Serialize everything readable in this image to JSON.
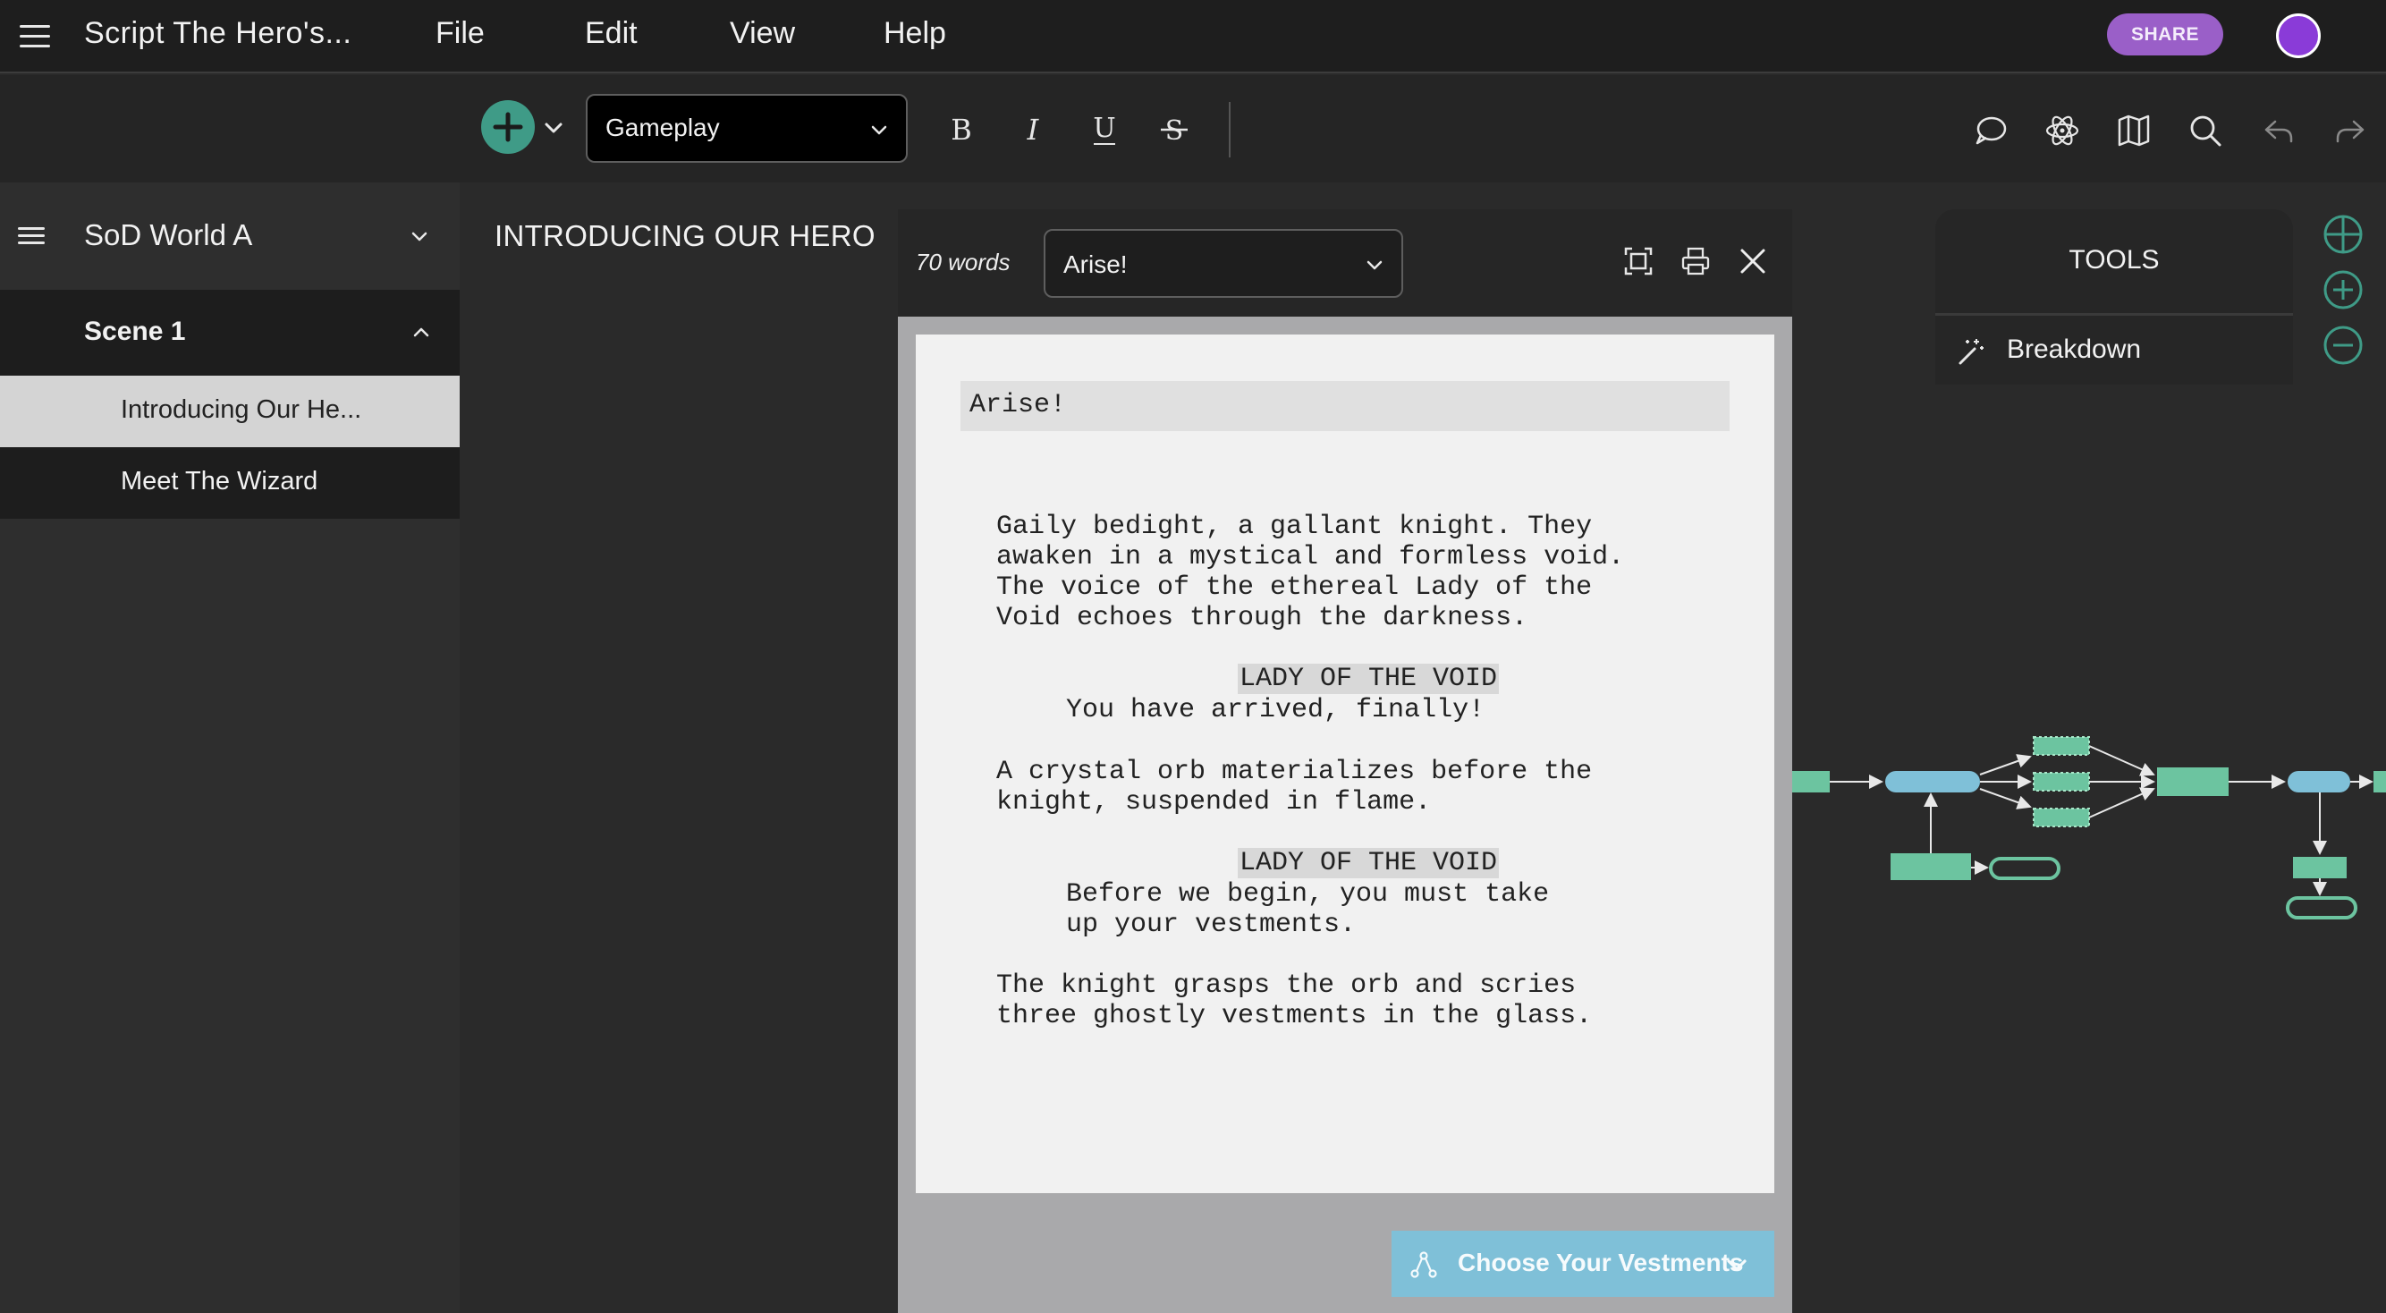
{
  "app": {
    "title": "Script The Hero's...",
    "menu": [
      "File",
      "Edit",
      "View",
      "Help"
    ],
    "share_label": "SHARE",
    "avatar_color": "#8a3bd8"
  },
  "toolbar": {
    "block_type": "Gameplay",
    "format_buttons": [
      "bold-icon",
      "italic-icon",
      "underline-icon",
      "strikethrough-icon"
    ],
    "right_tools": [
      "comment-icon",
      "atom-icon",
      "map-icon",
      "search-icon",
      "undo-icon",
      "redo-icon"
    ]
  },
  "sidebar": {
    "world": "SoD World A",
    "scene": "Scene 1",
    "items": [
      "Introducing Our He...",
      "Meet The Wizard"
    ]
  },
  "main": {
    "scene_heading": "INTRODUCING OUR HERO"
  },
  "editor": {
    "word_count": "70 words",
    "selected_block": "Arise!",
    "heading": "Arise!",
    "action1": [
      "Gaily bedight, a gallant knight. They",
      "awaken in a mystical and formless void.",
      "The voice of the ethereal Lady of the",
      "Void echoes through the darkness."
    ],
    "char1": "LADY OF THE VOID",
    "dialogue1": [
      "You have arrived, finally!"
    ],
    "action2": [
      "A crystal orb materializes before the",
      "knight, suspended in flame."
    ],
    "char2": "LADY OF THE VOID",
    "dialogue2": [
      "Before we begin, you must take",
      "up your vestments."
    ],
    "action3": [
      "The knight grasps the orb and scries",
      "three ghostly vestments in the glass."
    ],
    "choice_label": "Choose Your Vestments"
  },
  "tools": {
    "title": "TOOLS",
    "breakdown_label": "Breakdown"
  },
  "colors": {
    "accent_green": "#3f9b87",
    "node_green": "#6cc4a0",
    "node_blue": "#7fc0d8",
    "share_purple": "#9a5fc8"
  }
}
